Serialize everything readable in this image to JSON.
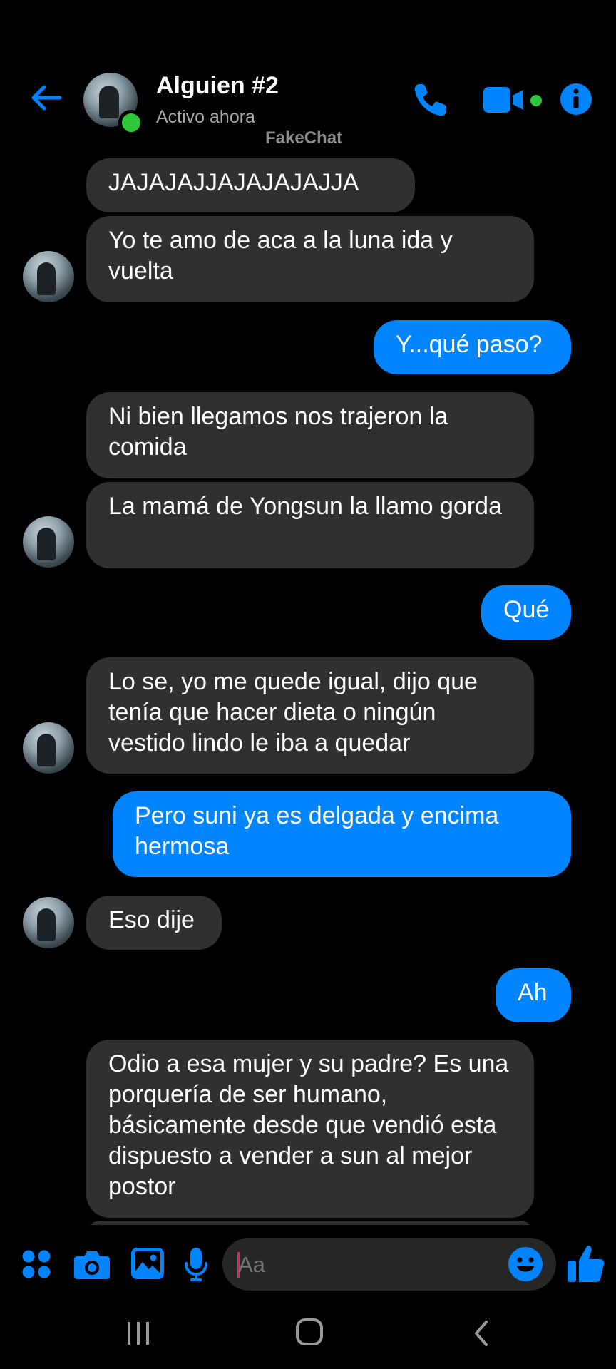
{
  "header": {
    "contact_name": "Alguien #2",
    "status": "Activo ahora",
    "watermark": "FakeChat",
    "icons": [
      "back-arrow-icon",
      "phone-icon",
      "video-camera-icon",
      "info-icon"
    ],
    "accent_color": "#0084ff",
    "online_color": "#31c73c"
  },
  "messages": [
    {
      "side": "in",
      "text": "JAJAJAJJAJAJAJAJJA"
    },
    {
      "side": "in",
      "text": "Yo te amo de aca a la luna ida y vuelta"
    },
    {
      "side": "out",
      "text": "Y...qué paso?"
    },
    {
      "side": "in",
      "text": "Ni bien llegamos nos trajeron la comida"
    },
    {
      "side": "in",
      "text": "La mamá de Yongsun la llamo gorda"
    },
    {
      "side": "out",
      "text": "Qué"
    },
    {
      "side": "in",
      "text": "Lo se, yo me quede igual, dijo que tenía que hacer dieta o ningún vestido lindo le iba a quedar"
    },
    {
      "side": "out",
      "text": "Pero suni ya es delgada y encima hermosa"
    },
    {
      "side": "in",
      "text": "Eso dije"
    },
    {
      "side": "out",
      "text": "Ah"
    },
    {
      "side": "in",
      "text": "Odio a esa mujer y su padre? Es una porquería de ser humano, básicamente desde que vendió esta dispuesto a vender a sun al mejor postor"
    }
  ],
  "composer": {
    "placeholder": "Aa",
    "icons": [
      "apps-icon",
      "camera-icon",
      "image-icon",
      "microphone-icon",
      "emoji-icon",
      "thumbs-up-icon"
    ]
  },
  "colors": {
    "incoming_bubble": "#303030",
    "outgoing_bubble": "#0084ff",
    "background": "#000000"
  }
}
